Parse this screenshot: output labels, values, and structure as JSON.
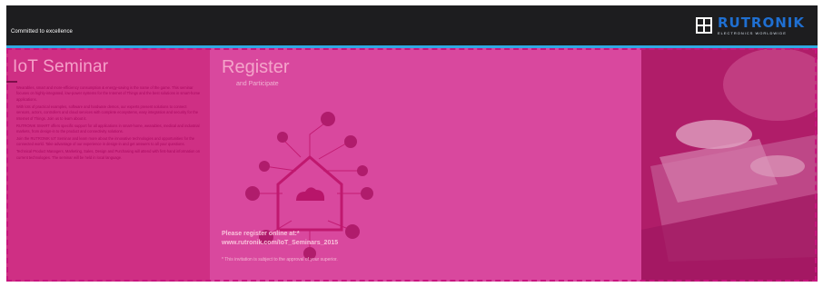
{
  "header": {
    "tagline": "Committed to excellence",
    "logo_name": "RUTRONIK",
    "logo_sub": "ELECTRONICS WORLDWIDE"
  },
  "left": {
    "title": "IoT Seminar",
    "paragraphs": [
      "Wearables, smart and more-efficiency consumption & energy-saving is the name of the game. This seminar focuses on highly-integrated, low-power systems for the Internet of Things and the best solutions in smart-home applications.",
      "With lots of practical examples, software and hardware demos, our experts present solutions to connect sensors, actors, controllers and cloud services with complete ecosystems, easy integration and security for the Internet of Things. Join us to learn about it.",
      "RUTRONIK SMART offers specific support for all applications in smart-home, wearables, medical and industrial markets, from design-in to the product and connectivity solutions.",
      "Join the RUTRONIK IoT Seminar and learn more about the innovative technologies and opportunities for the connected world. Take advantage of our experience in design-in and get answers to all your questions.",
      "Technical Product Managers, Marketing, Sales, Design and Purchasing will attend with first-hand information on current technologies. The seminar will be held in local language."
    ]
  },
  "middle": {
    "register_title": "Register",
    "register_sub": "and Participate",
    "online_line1": "Please register online at:*",
    "online_line2": "www.rutronik.com/IoT_Seminars_2015",
    "note": "* This invitation is subject to the approval of your superior."
  },
  "icons": {
    "house": "smart-home-house-icon",
    "cloud": "cloud-icon"
  },
  "colors": {
    "overlay": "#d1338d",
    "header": "#1d1d1f",
    "accent_blue": "#2fa9e3",
    "logo_blue": "#1f6fd1",
    "dash": "#c7157e"
  }
}
